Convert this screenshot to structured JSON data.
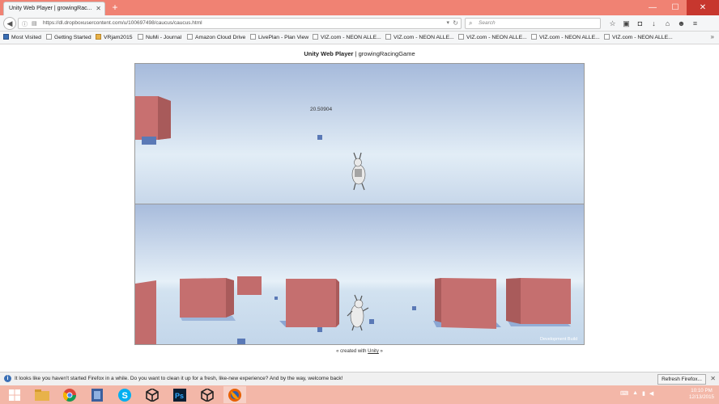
{
  "browser": {
    "tab_title": "Unity Web Player | growingRac...",
    "url": "https://dl.dropboxusercontent.com/u/100697498/caucus/caucus.html",
    "search_placeholder": "Search"
  },
  "bookmarks": [
    {
      "label": "Most Visited",
      "icon": "gear-icon"
    },
    {
      "label": "Getting Started",
      "icon": "page-icon"
    },
    {
      "label": "VRjam2015",
      "icon": "folder-icon"
    },
    {
      "label": "NuMi - Journal",
      "icon": "page-icon"
    },
    {
      "label": "Amazon Cloud Drive",
      "icon": "page-icon"
    },
    {
      "label": "LivePlan - Plan View",
      "icon": "page-icon"
    },
    {
      "label": "VIZ.com - NEON ALLE...",
      "icon": "page-icon"
    },
    {
      "label": "VIZ.com - NEON ALLE...",
      "icon": "page-icon"
    },
    {
      "label": "VIZ.com - NEON ALLE...",
      "icon": "page-icon"
    },
    {
      "label": "VIZ.com - NEON ALLE...",
      "icon": "page-icon"
    },
    {
      "label": "VIZ.com - NEON ALLE...",
      "icon": "page-icon"
    }
  ],
  "page": {
    "title_bold": "Unity Web Player",
    "title_rest": " | growingRacingGame",
    "credit_prefix": "« created with ",
    "credit_link": "Unity",
    "credit_suffix": " »"
  },
  "game": {
    "score": "20.50904",
    "watermark": "Development Build",
    "colors": {
      "sky_top": "#a9bedd",
      "sky_horizon": "#dde9f4",
      "cube": "#c26c6c",
      "small_cube": "#5b7ab8"
    }
  },
  "notification": {
    "text": "It looks like you haven't started Firefox in a while. Do you want to clean it up for a fresh, like-new experience? And by the way, welcome back!",
    "button": "Refresh Firefox..."
  },
  "taskbar": {
    "apps": [
      "windows-start-icon",
      "file-explorer-icon",
      "chrome-icon",
      "app-icon",
      "skype-icon",
      "unity-icon",
      "photoshop-icon",
      "photoshop-icon",
      "unity-icon",
      "firefox-icon"
    ],
    "time": "10:10 PM",
    "date": "12/13/2015"
  }
}
